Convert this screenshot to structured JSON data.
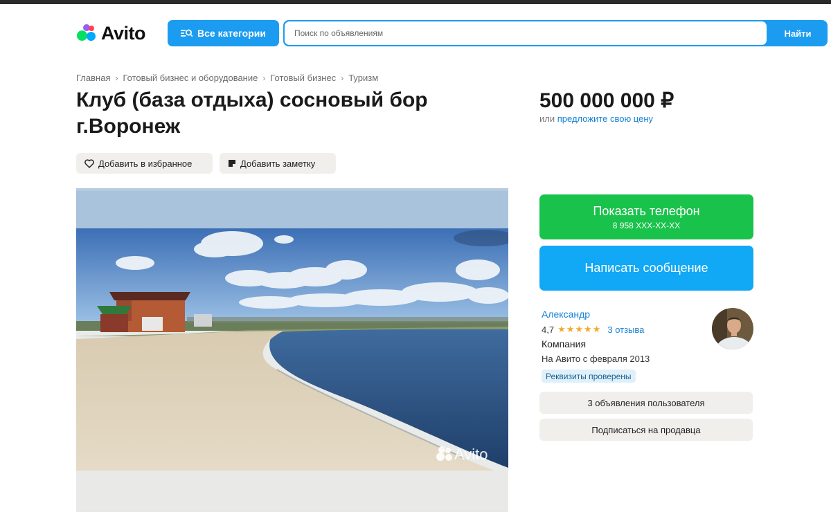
{
  "header": {
    "logo_text": "Avito",
    "categories_label": "Все категории",
    "search_placeholder": "Поиск по объявлениям",
    "search_button": "Найти"
  },
  "breadcrumbs": [
    "Главная",
    "Готовый бизнес и оборудование",
    "Готовый бизнес",
    "Туризм"
  ],
  "listing": {
    "title_line1": "Клуб (база отдыха) сосновый бор",
    "title_line2": "г.Воронеж",
    "price": "500 000 000 ₽",
    "offer_prefix": "или",
    "offer_link": "предложите свою цену",
    "favorite_label": "Добавить в избранное",
    "note_label": "Добавить заметку",
    "photo_watermark": "Avito"
  },
  "contact": {
    "show_phone_label": "Показать телефон",
    "phone_masked": "8 958 XXX-XX-XX",
    "message_label": "Написать сообщение"
  },
  "seller": {
    "name": "Александр",
    "rating": "4,7",
    "reviews_label": "3 отзыва",
    "type": "Компания",
    "since": "На Авито с февраля 2013",
    "verified_badge": "Реквизиты проверены",
    "listings_button": "3 объявления пользователя",
    "subscribe_button": "Подписаться на продавца"
  },
  "colors": {
    "brand_blue": "#1b9cf0",
    "phone_green": "#19c24a",
    "message_blue": "#11a8f5",
    "link_blue": "#1582d6",
    "star_orange": "#f4a92b"
  }
}
